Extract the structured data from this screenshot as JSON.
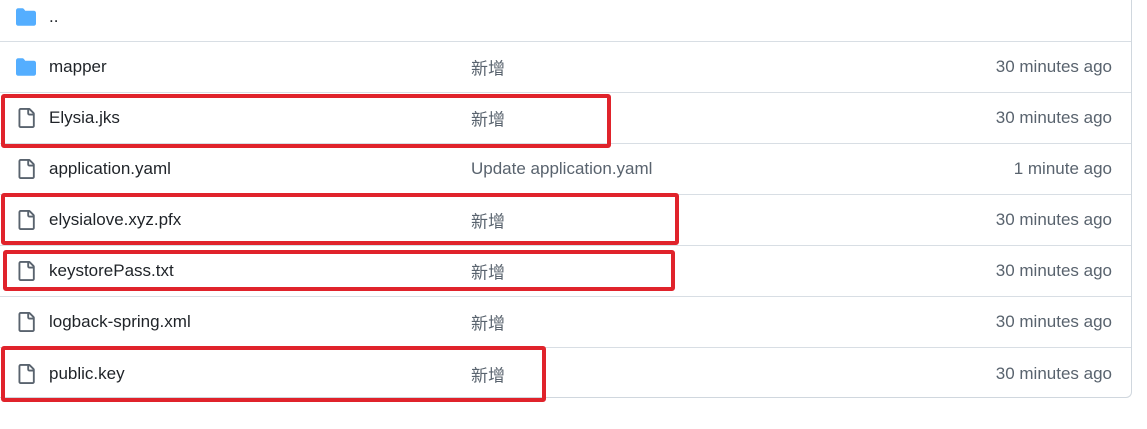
{
  "parent_row": {
    "icon": "folder-icon",
    "name": ".."
  },
  "files": [
    {
      "icon": "folder-icon",
      "name": "mapper",
      "message": "新增",
      "age": "30 minutes ago"
    },
    {
      "icon": "file-icon",
      "name": "Elysia.jks",
      "message": "新增",
      "age": "30 minutes ago"
    },
    {
      "icon": "file-icon",
      "name": "application.yaml",
      "message": "Update application.yaml",
      "age": "1 minute ago"
    },
    {
      "icon": "file-icon",
      "name": "elysialove.xyz.pfx",
      "message": "新增",
      "age": "30 minutes ago"
    },
    {
      "icon": "file-icon",
      "name": "keystorePass.txt",
      "message": "新增",
      "age": "30 minutes ago"
    },
    {
      "icon": "file-icon",
      "name": "logback-spring.xml",
      "message": "新增",
      "age": "30 minutes ago"
    },
    {
      "icon": "file-icon",
      "name": "public.key",
      "message": "新增",
      "age": "30 minutes ago"
    }
  ],
  "annotation_color": "#e0232b",
  "folder_color": "#54aeff",
  "file_icon_color": "#59636e"
}
